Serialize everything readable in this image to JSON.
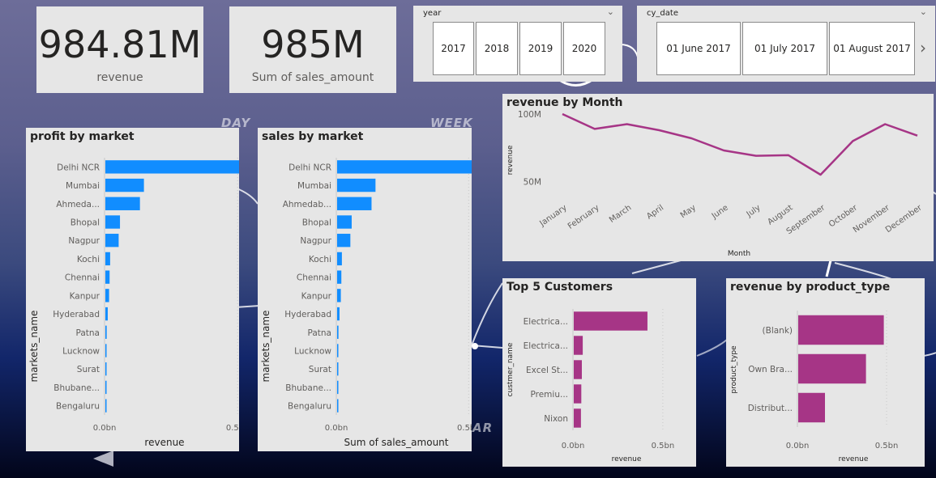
{
  "kpi": [
    {
      "value": "984.81M",
      "label": "revenue"
    },
    {
      "value": "985M",
      "label": "Sum of sales_amount"
    }
  ],
  "year_slicer": {
    "title": "year",
    "options": [
      "2017",
      "2018",
      "2019",
      "2020"
    ]
  },
  "date_slicer": {
    "title": "cy_date",
    "options": [
      "01 June 2017",
      "01 July 2017",
      "01 August 2017"
    ]
  },
  "background_words": [
    "DAY",
    "WEEK",
    "AR"
  ],
  "colors": {
    "market_bar": "#118dff",
    "magenta": "#a63586",
    "card_bg": "#e6e6e6"
  },
  "chart_data": [
    {
      "id": "profit_by_market",
      "type": "bar",
      "orientation": "horizontal",
      "title": "profit by market",
      "xlabel": "revenue",
      "ylabel": "markets_name",
      "categories": [
        "Delhi NCR",
        "Mumbai",
        "Ahmeda...",
        "Bhopal",
        "Nagpur",
        "Kochi",
        "Chennai",
        "Kanpur",
        "Hyderabad",
        "Patna",
        "Lucknow",
        "Surat",
        "Bhubane...",
        "Bengaluru"
      ],
      "values": [
        0.52,
        0.145,
        0.13,
        0.055,
        0.05,
        0.018,
        0.016,
        0.014,
        0.009,
        0.005,
        0.003,
        0.002,
        0.001,
        0.0005
      ],
      "xlim": [
        0,
        0.6
      ],
      "xticks": [
        0,
        0.5
      ],
      "xtick_labels": [
        "0.0bn",
        "0.5bn"
      ],
      "grid": true
    },
    {
      "id": "sales_by_market",
      "type": "bar",
      "orientation": "horizontal",
      "title": "sales by market",
      "xlabel": "Sum of sales_amount",
      "ylabel": "markets_name",
      "categories": [
        "Delhi NCR",
        "Mumbai",
        "Ahmedab...",
        "Bhopal",
        "Nagpur",
        "Kochi",
        "Chennai",
        "Kanpur",
        "Hyderabad",
        "Patna",
        "Lucknow",
        "Surat",
        "Bhubane...",
        "Bengaluru"
      ],
      "values": [
        0.52,
        0.145,
        0.13,
        0.055,
        0.05,
        0.018,
        0.016,
        0.014,
        0.009,
        0.005,
        0.003,
        0.002,
        0.001,
        0.0005
      ],
      "xlim": [
        0,
        0.6
      ],
      "xticks": [
        0,
        0.5
      ],
      "xtick_labels": [
        "0.0bn",
        "0.5bn"
      ],
      "grid": true
    },
    {
      "id": "revenue_by_month",
      "type": "line",
      "title": "revenue by Month",
      "xlabel": "Month",
      "ylabel": "revenue",
      "categories": [
        "January",
        "February",
        "March",
        "April",
        "May",
        "June",
        "July",
        "August",
        "September",
        "October",
        "November",
        "December"
      ],
      "values": [
        100,
        89,
        92.5,
        88,
        82,
        73,
        69,
        69.5,
        55,
        80,
        92.5,
        84
      ],
      "ylim": [
        40,
        103
      ],
      "yticks": [
        50,
        100
      ],
      "ytick_labels": [
        "50M",
        "100M"
      ],
      "grid": false
    },
    {
      "id": "top5_customers",
      "type": "bar",
      "orientation": "horizontal",
      "title": "Top 5 Customers",
      "xlabel": "revenue",
      "ylabel": "custmer_name",
      "categories": [
        "Electrica...",
        "Electrica...",
        "Excel St...",
        "Premiu...",
        "Nixon"
      ],
      "values": [
        0.41,
        0.05,
        0.045,
        0.042,
        0.04
      ],
      "xlim": [
        0,
        0.55
      ],
      "xticks": [
        0,
        0.5
      ],
      "xtick_labels": [
        "0.0bn",
        "0.5bn"
      ],
      "grid": true
    },
    {
      "id": "revenue_by_product_type",
      "type": "bar",
      "orientation": "horizontal",
      "title": "revenue by product_type",
      "xlabel": "revenue",
      "ylabel": "product_type",
      "categories": [
        "(Blank)",
        "Own Bra...",
        "Distribut..."
      ],
      "values": [
        0.48,
        0.38,
        0.15
      ],
      "xlim": [
        0,
        0.6
      ],
      "xticks": [
        0,
        0.5
      ],
      "xtick_labels": [
        "0.0bn",
        "0.5bn"
      ],
      "grid": true
    }
  ]
}
